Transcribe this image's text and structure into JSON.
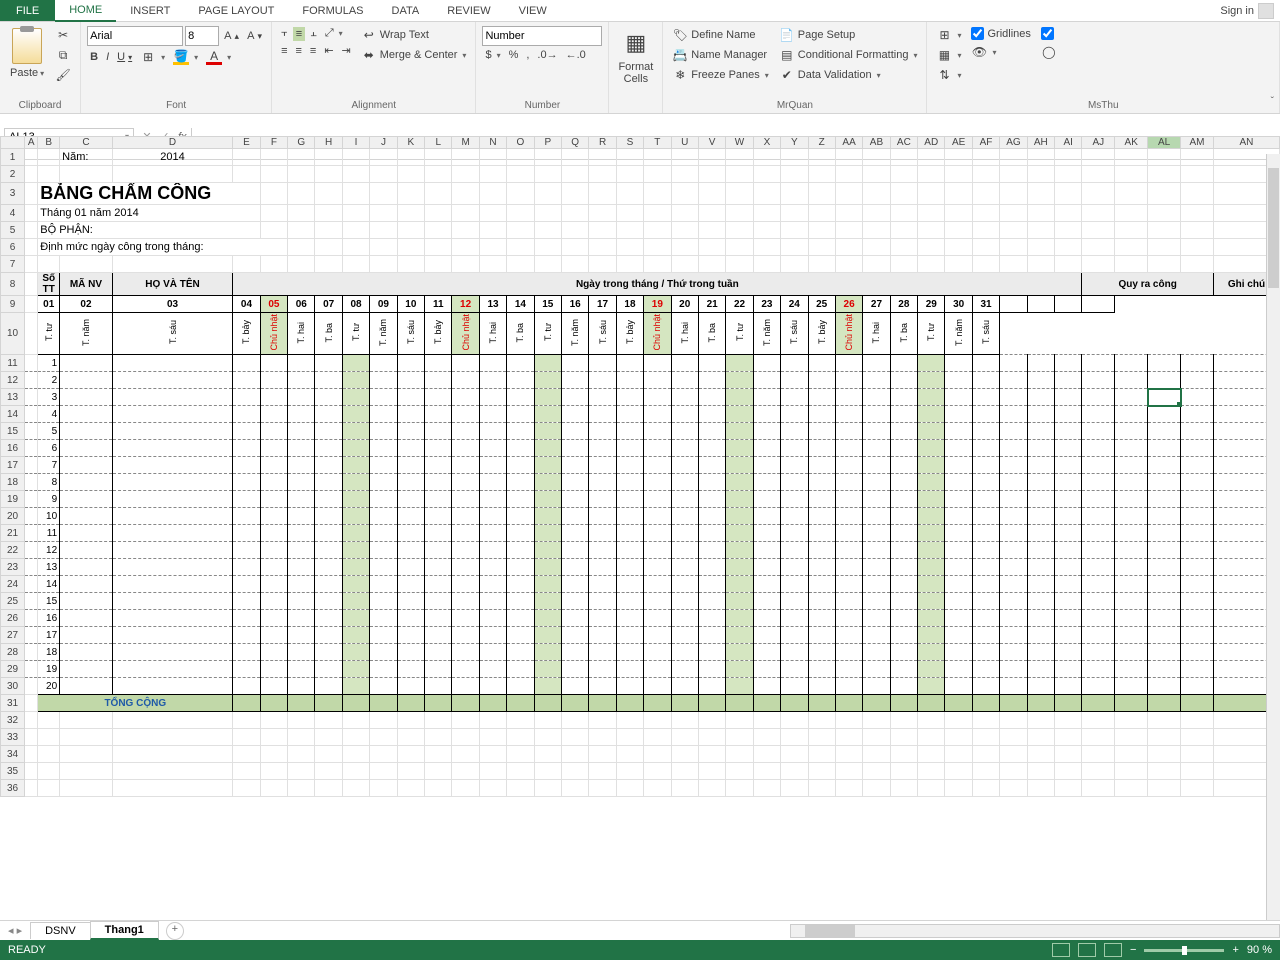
{
  "tabs": {
    "file": "FILE",
    "home": "HOME",
    "insert": "INSERT",
    "pagelayout": "PAGE LAYOUT",
    "formulas": "FORMULAS",
    "data": "DATA",
    "review": "REVIEW",
    "view": "VIEW"
  },
  "signin": "Sign in",
  "ribbon": {
    "clipboard": {
      "paste": "Paste",
      "label": "Clipboard"
    },
    "font": {
      "name": "Arial",
      "size": "8",
      "label": "Font"
    },
    "alignment": {
      "wrap": "Wrap Text",
      "merge": "Merge & Center",
      "label": "Alignment"
    },
    "number": {
      "format": "Number",
      "label": "Number"
    },
    "formatcells": {
      "btn": "Format\nCells"
    },
    "mrquan": {
      "define": "Define Name",
      "namemgr": "Name Manager",
      "freeze": "Freeze Panes",
      "pagesetup": "Page Setup",
      "condfmt": "Conditional Formatting",
      "dataval": "Data Validation",
      "label": "MrQuan"
    },
    "msthu": {
      "gridlines": "Gridlines",
      "label": "MsThu"
    }
  },
  "namebox": "AL13",
  "sheet": {
    "year_label": "Năm:",
    "year": "2014",
    "title": "BẢNG CHẤM CÔNG",
    "subtitle": "Tháng 01 năm 2014",
    "dept": "BỘ PHẬN:",
    "quota": "Định mức ngày công trong tháng:",
    "hdr_stt": "Số\nTT",
    "hdr_manv": "MÃ NV",
    "hdr_hoten": "HỌ VÀ TÊN",
    "hdr_days": "Ngày trong tháng / Thứ trong tuần",
    "hdr_quy": "Quy ra công",
    "hdr_ghichu": "Ghi chú",
    "days": [
      {
        "n": "01",
        "dow": "T. tư",
        "sun": false
      },
      {
        "n": "02",
        "dow": "T. năm",
        "sun": false
      },
      {
        "n": "03",
        "dow": "T. sáu",
        "sun": false
      },
      {
        "n": "04",
        "dow": "T. bảy",
        "sun": false
      },
      {
        "n": "05",
        "dow": "Chủ nhật",
        "sun": true
      },
      {
        "n": "06",
        "dow": "T. hai",
        "sun": false
      },
      {
        "n": "07",
        "dow": "T. ba",
        "sun": false
      },
      {
        "n": "08",
        "dow": "T. tư",
        "sun": false
      },
      {
        "n": "09",
        "dow": "T. năm",
        "sun": false
      },
      {
        "n": "10",
        "dow": "T. sáu",
        "sun": false
      },
      {
        "n": "11",
        "dow": "T. bảy",
        "sun": false
      },
      {
        "n": "12",
        "dow": "Chủ nhật",
        "sun": true
      },
      {
        "n": "13",
        "dow": "T. hai",
        "sun": false
      },
      {
        "n": "14",
        "dow": "T. ba",
        "sun": false
      },
      {
        "n": "15",
        "dow": "T. tư",
        "sun": false
      },
      {
        "n": "16",
        "dow": "T. năm",
        "sun": false
      },
      {
        "n": "17",
        "dow": "T. sáu",
        "sun": false
      },
      {
        "n": "18",
        "dow": "T. bảy",
        "sun": false
      },
      {
        "n": "19",
        "dow": "Chủ nhật",
        "sun": true
      },
      {
        "n": "20",
        "dow": "T. hai",
        "sun": false
      },
      {
        "n": "21",
        "dow": "T. ba",
        "sun": false
      },
      {
        "n": "22",
        "dow": "T. tư",
        "sun": false
      },
      {
        "n": "23",
        "dow": "T. năm",
        "sun": false
      },
      {
        "n": "24",
        "dow": "T. sáu",
        "sun": false
      },
      {
        "n": "25",
        "dow": "T. bảy",
        "sun": false
      },
      {
        "n": "26",
        "dow": "Chủ nhật",
        "sun": true
      },
      {
        "n": "27",
        "dow": "T. hai",
        "sun": false
      },
      {
        "n": "28",
        "dow": "T. ba",
        "sun": false
      },
      {
        "n": "29",
        "dow": "T. tư",
        "sun": false
      },
      {
        "n": "30",
        "dow": "T. năm",
        "sun": false
      },
      {
        "n": "31",
        "dow": "T. sáu",
        "sun": false
      }
    ],
    "total": "TỔNG CỘNG",
    "cols": [
      "A",
      "B",
      "C",
      "D",
      "E",
      "F",
      "G",
      "H",
      "I",
      "J",
      "K",
      "L",
      "M",
      "N",
      "O",
      "P",
      "Q",
      "R",
      "S",
      "T",
      "U",
      "V",
      "W",
      "X",
      "Y",
      "Z",
      "AA",
      "AB",
      "AC",
      "AD",
      "AE",
      "AF",
      "AG",
      "AH",
      "AI",
      "AJ",
      "AK",
      "AL",
      "AM",
      "AN"
    ]
  },
  "sheettabs": {
    "s1": "DSNV",
    "s2": "Thang1"
  },
  "status": {
    "ready": "READY",
    "zoom": "90 %"
  }
}
